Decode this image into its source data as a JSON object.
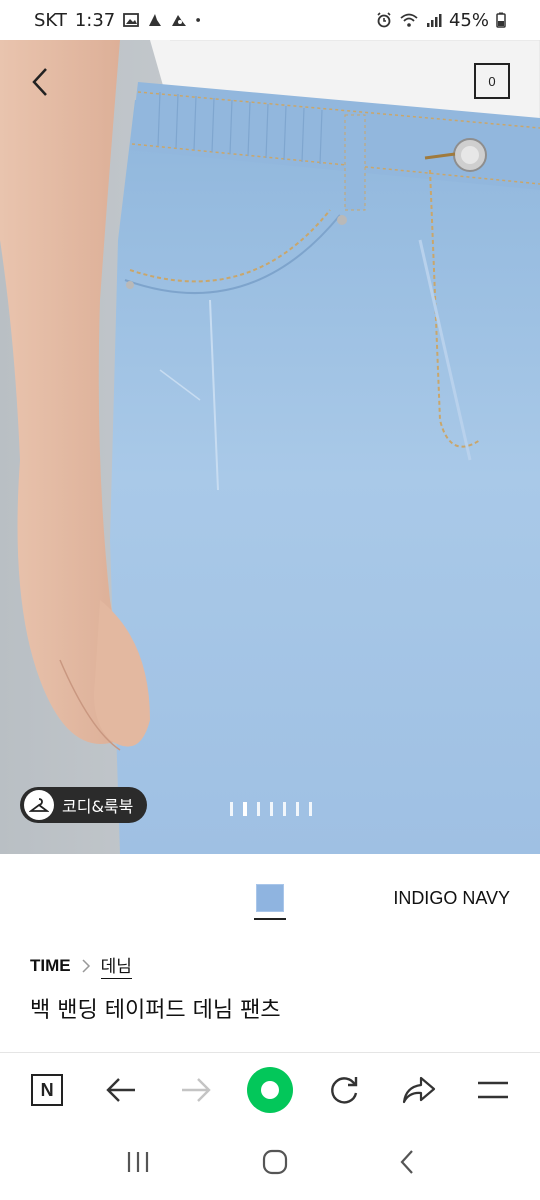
{
  "status_bar": {
    "carrier": "SKT",
    "time": "1:37",
    "battery": "45%",
    "icons": [
      "image-icon",
      "app-icon",
      "app-icon",
      "dot-icon",
      "alarm-icon",
      "wifi-icon",
      "signal-icon",
      "battery-icon"
    ]
  },
  "hero": {
    "cart_count": "0",
    "coordi_label": "코디&룩북",
    "slide_count": 7,
    "active_slide": 2
  },
  "product": {
    "color_name": "INDIGO NAVY",
    "swatch_color": "#8fb4e0",
    "brand": "TIME",
    "category": "데님",
    "title": "백 밴딩 테이퍼드 데님 팬츠"
  },
  "toolbar": {
    "home_label": "N",
    "accent": "#03c75a"
  }
}
